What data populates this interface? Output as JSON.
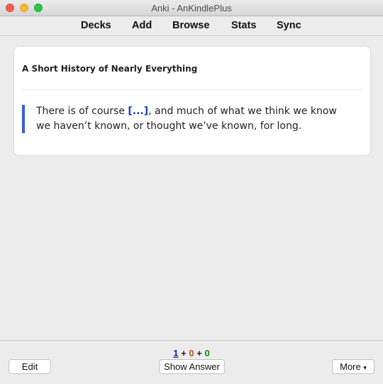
{
  "window": {
    "title": "Anki - AnKindlePlus"
  },
  "toolbar": {
    "items": [
      {
        "label": "Decks"
      },
      {
        "label": "Add"
      },
      {
        "label": "Browse"
      },
      {
        "label": "Stats"
      },
      {
        "label": "Sync"
      }
    ]
  },
  "card": {
    "title": "A Short History of Nearly Everything",
    "text_before": "There is of course ",
    "cloze": "[...]",
    "text_after": ", and much of what we think we know we haven’t known, or thought we’ve known, for long."
  },
  "bottom": {
    "edit_label": "Edit",
    "show_answer_label": "Show Answer",
    "more_label": "More",
    "more_caret": "▾",
    "counts": {
      "new": "1",
      "learning": "0",
      "review": "0",
      "separator": "+"
    }
  },
  "colors": {
    "cloze": "#1a3cc4",
    "quote_bar": "#3a5fe0",
    "new_count": "#1a1aa6",
    "learning_count": "#c35617",
    "review_count": "#128a12"
  }
}
